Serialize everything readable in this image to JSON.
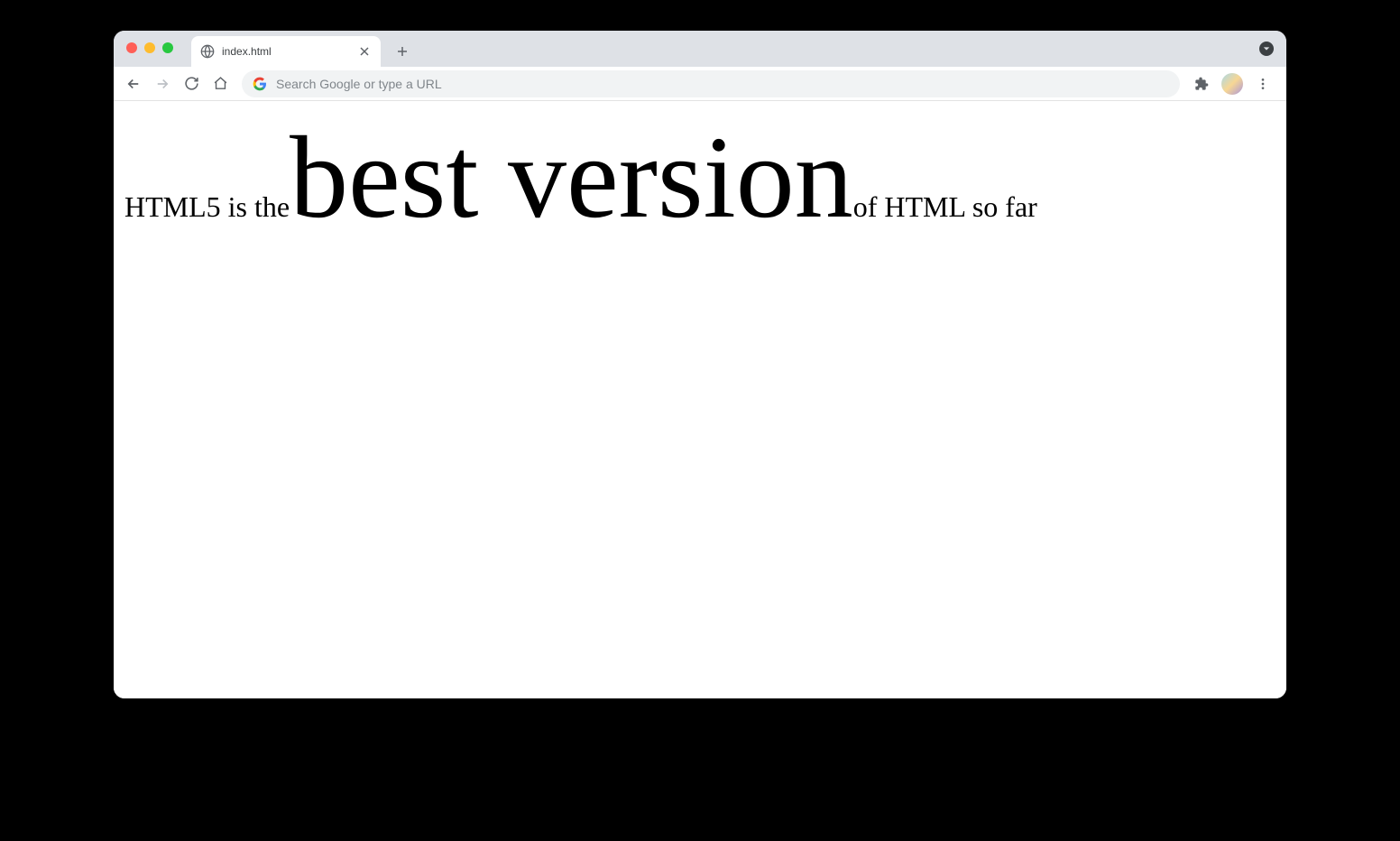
{
  "tab": {
    "title": "index.html"
  },
  "omnibox": {
    "placeholder": "Search Google or type a URL"
  },
  "content": {
    "part1": "HTML5 is the",
    "big": "best version",
    "part2": "of HTML so far"
  }
}
